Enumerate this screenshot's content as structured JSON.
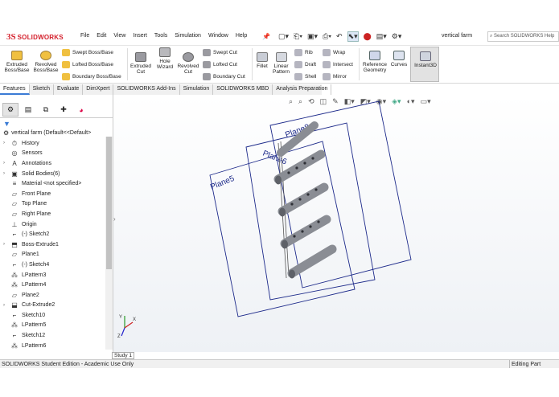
{
  "app": {
    "logo_ds": "3S",
    "logo_name": "SOLIDWORKS",
    "doc_title": "vertical farm",
    "search_placeholder": "Search SOLIDWORKS Help"
  },
  "menu": [
    "File",
    "Edit",
    "View",
    "Insert",
    "Tools",
    "Simulation",
    "Window",
    "Help"
  ],
  "ribbon": {
    "extruded_boss": [
      "Extruded",
      "Boss/Base"
    ],
    "revolved_boss": [
      "Revolved",
      "Boss/Base"
    ],
    "swept_boss": "Swept Boss/Base",
    "lofted_boss": "Lofted Boss/Base",
    "boundary_boss": "Boundary Boss/Base",
    "extruded_cut": [
      "Extruded",
      "Cut"
    ],
    "hole_wizard": [
      "Hole",
      "Wizard"
    ],
    "revolved_cut": [
      "Revolved",
      "Cut"
    ],
    "swept_cut": "Swept Cut",
    "lofted_cut": "Lofted Cut",
    "boundary_cut": "Boundary Cut",
    "fillet": "Fillet",
    "linear_pattern": [
      "Linear",
      "Pattern"
    ],
    "rib": "Rib",
    "draft": "Draft",
    "shell": "Shell",
    "wrap": "Wrap",
    "intersect": "Intersect",
    "mirror": "Mirror",
    "reference_geometry": [
      "Reference",
      "Geometry"
    ],
    "curves": "Curves",
    "instant3d": "Instant3D"
  },
  "tabs": [
    "Features",
    "Sketch",
    "Evaluate",
    "DimXpert",
    "SOLIDWORKS Add-Ins",
    "Simulation",
    "SOLIDWORKS MBD",
    "Analysis Preparation"
  ],
  "tree": {
    "root": "vertical farm  (Default<<Default>",
    "items": [
      {
        "label": "History",
        "icon": "history-icon",
        "arrow": true
      },
      {
        "label": "Sensors",
        "icon": "sensor-icon",
        "arrow": false
      },
      {
        "label": "Annotations",
        "icon": "annotation-icon",
        "arrow": true
      },
      {
        "label": "Solid Bodies(6)",
        "icon": "solid-bodies-icon",
        "arrow": true
      },
      {
        "label": "Material <not specified>",
        "icon": "material-icon",
        "arrow": false
      },
      {
        "label": "Front Plane",
        "icon": "plane-icon",
        "arrow": false
      },
      {
        "label": "Top Plane",
        "icon": "plane-icon",
        "arrow": false
      },
      {
        "label": "Right Plane",
        "icon": "plane-icon",
        "arrow": false
      },
      {
        "label": "Origin",
        "icon": "origin-icon",
        "arrow": false
      },
      {
        "label": "(-) Sketch2",
        "icon": "sketch-icon",
        "arrow": false
      },
      {
        "label": "Boss-Extrude1",
        "icon": "extrude-icon",
        "arrow": true
      },
      {
        "label": "Plane1",
        "icon": "plane-icon",
        "arrow": false
      },
      {
        "label": "(-) Sketch4",
        "icon": "sketch-icon",
        "arrow": false
      },
      {
        "label": "LPattern3",
        "icon": "pattern-icon",
        "arrow": false
      },
      {
        "label": "LPattern4",
        "icon": "pattern-icon",
        "arrow": false
      },
      {
        "label": "Plane2",
        "icon": "plane-icon",
        "arrow": false
      },
      {
        "label": "Cut-Extrude2",
        "icon": "cut-extrude-icon",
        "arrow": true
      },
      {
        "label": "Sketch10",
        "icon": "sketch-icon",
        "arrow": false
      },
      {
        "label": "LPattern5",
        "icon": "pattern-icon",
        "arrow": false
      },
      {
        "label": "Sketch12",
        "icon": "sketch-icon",
        "arrow": false
      },
      {
        "label": "LPattern6",
        "icon": "pattern-icon",
        "arrow": false
      }
    ]
  },
  "viewport": {
    "plane_labels": [
      "Plane8",
      "Plane6",
      "Plane5"
    ],
    "triad": {
      "y": "Y",
      "x": "X",
      "z": "Z"
    }
  },
  "study_tab": "Study 1",
  "status": {
    "left": "SOLIDWORKS Student Edition - Academic Use Only",
    "right": "Editing Part"
  },
  "colors": {
    "brand": "#d4202c",
    "plane": "#1d2a8a",
    "rod": "#8a8d94",
    "accent": "#3a7bd5"
  }
}
